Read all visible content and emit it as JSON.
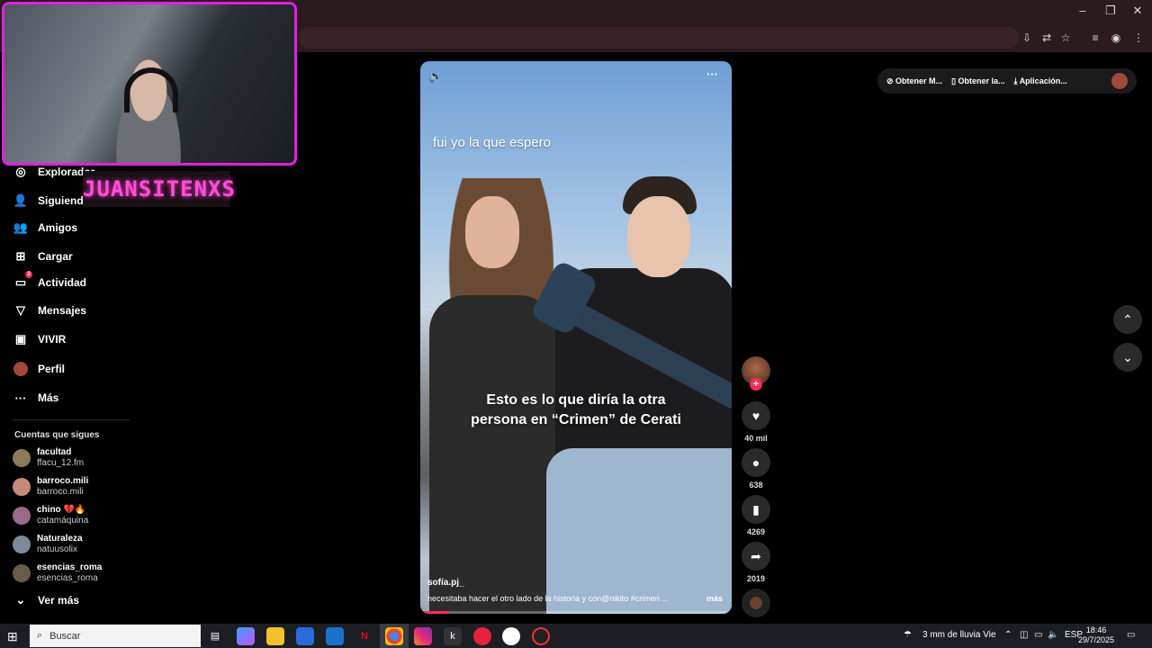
{
  "browser": {
    "window_controls": [
      "–",
      "❐",
      "✕"
    ]
  },
  "streamer_tag": "JUANSITENXS",
  "sidebar": {
    "items": [
      {
        "label": "Explorador",
        "icon": "compass-icon"
      },
      {
        "label": "Siguiendo",
        "icon": "following-icon"
      },
      {
        "label": "Amigos",
        "icon": "friends-icon"
      },
      {
        "label": "Cargar",
        "icon": "upload-icon"
      },
      {
        "label": "Actividad",
        "icon": "activity-icon",
        "badge": "3"
      },
      {
        "label": "Mensajes",
        "icon": "messages-icon"
      },
      {
        "label": "VIVIR",
        "icon": "live-icon"
      },
      {
        "label": "Perfil",
        "icon": "profile-avatar-icon"
      },
      {
        "label": "Más",
        "icon": "more-dots-icon"
      }
    ],
    "section_title": "Cuentas que sigues",
    "following": [
      {
        "name": "facultad",
        "handle": "ffacu_12.fm"
      },
      {
        "name": "barroco.mili",
        "handle": "barroco.mili"
      },
      {
        "name": "chino 💔🔥",
        "handle": "catamáquina"
      },
      {
        "name": "Naturaleza",
        "handle": "natuusolix"
      },
      {
        "name": "esencias_roma",
        "handle": "esencias_roma"
      }
    ],
    "see_more": "Ver más"
  },
  "video": {
    "top_text": "fui yo la que espero",
    "caption": "Esto es lo que diría la otra persona en “Crimen” de Cerati",
    "username": "sofía.pj_",
    "description": "necesitaba hacer el otro lado de la historia y con@nikito  #crimen ...",
    "more_label": "más",
    "progress": 0.09
  },
  "actions": {
    "likes": "40 mil",
    "comments": "638",
    "saves": "4269",
    "shares": "2019"
  },
  "top_right": {
    "items": [
      "Obtener M...",
      "Obtener la...",
      "Aplicación..."
    ]
  },
  "taskbar": {
    "search_placeholder": "Buscar",
    "weather": "3 mm de lluvia Vie",
    "language": "ESP",
    "time": "18:46",
    "date": "29/7/2025"
  }
}
